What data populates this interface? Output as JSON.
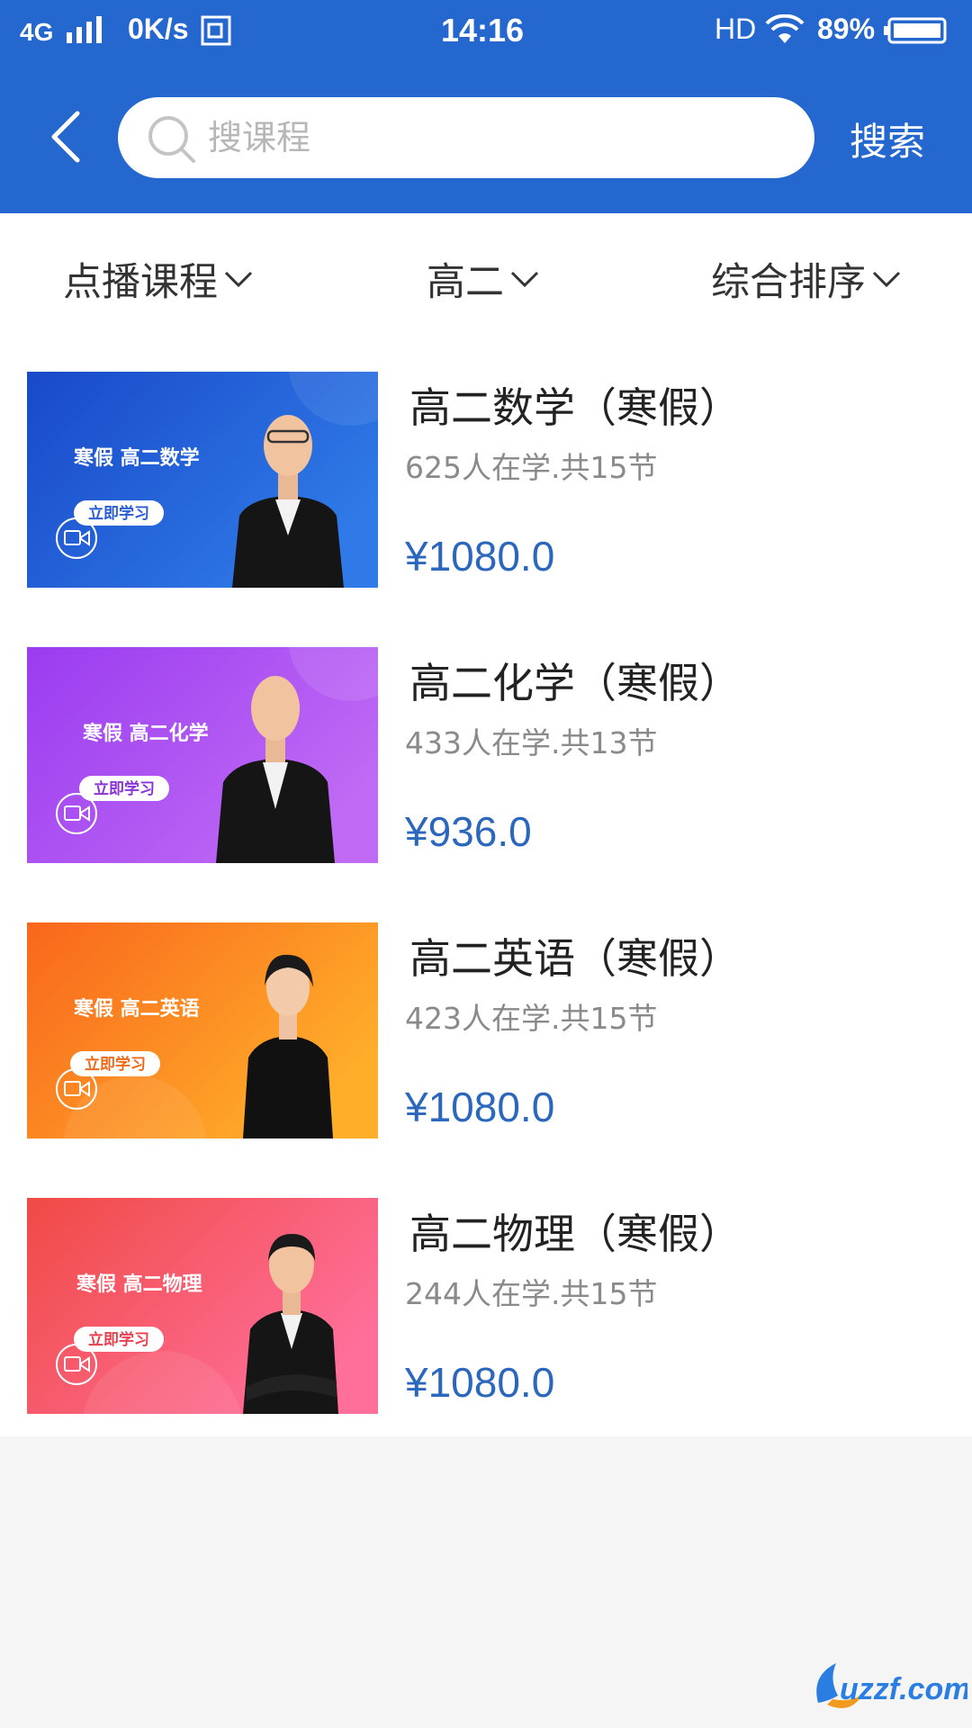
{
  "status_bar": {
    "network": "4G",
    "speed": "0K/s",
    "time": "14:16",
    "hd": "HD",
    "battery": "89%"
  },
  "header": {
    "back_icon": "chevron-left-icon",
    "search_placeholder": "搜课程",
    "search_icon": "search-icon",
    "search_button": "搜索"
  },
  "filters": [
    {
      "label": "点播课程",
      "icon": "chevron-down-icon"
    },
    {
      "label": "高二",
      "icon": "chevron-down-icon"
    },
    {
      "label": "综合排序",
      "icon": "chevron-down-icon"
    }
  ],
  "courses": [
    {
      "title": "高二数学（寒假）",
      "meta": "625人在学.共15节",
      "price": "¥1080.0",
      "thumb_text": "寒假 高二数学",
      "thumb_button": "立即学习",
      "thumb_color_start": "#1949c8",
      "thumb_color_end": "#2f7ae8"
    },
    {
      "title": "高二化学（寒假）",
      "meta": "433人在学.共13节",
      "price": "¥936.0",
      "thumb_text": "寒假 高二化学",
      "thumb_button": "立即学习",
      "thumb_color_start": "#9a3cf0",
      "thumb_color_end": "#c06af5"
    },
    {
      "title": "高二英语（寒假）",
      "meta": "423人在学.共15节",
      "price": "¥1080.0",
      "thumb_text": "寒假 高二英语",
      "thumb_button": "立即学习",
      "thumb_color_start": "#f9661c",
      "thumb_color_end": "#ffae2a"
    },
    {
      "title": "高二物理（寒假）",
      "meta": "244人在学.共15节",
      "price": "¥1080.0",
      "thumb_text": "寒假 高二物理",
      "thumb_button": "立即学习",
      "thumb_color_start": "#f04a45",
      "thumb_color_end": "#ff6f9a"
    }
  ],
  "watermark": {
    "text": "uzzf.com"
  },
  "colors": {
    "brand": "#2367cf",
    "price": "#2b67bd"
  }
}
